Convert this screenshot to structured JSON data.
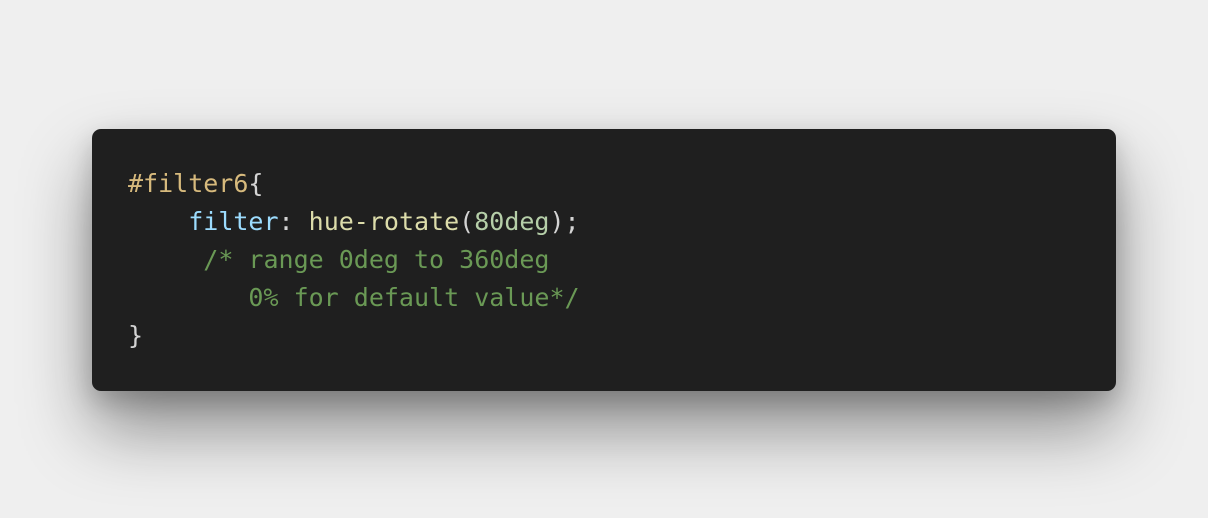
{
  "snippet": {
    "selector": "#filter6",
    "open_brace": "{",
    "property": "filter",
    "colon": ": ",
    "function_name": "hue-rotate",
    "paren_open": "(",
    "argument": "80deg",
    "paren_close_semicolon": ");",
    "comment_line_1": "/* range 0deg to 360deg",
    "comment_line_2": "0% for default value*/",
    "close_brace": "}"
  },
  "colors": {
    "page_background": "#efefef",
    "editor_background": "#1f1f1f",
    "selector": "#d7ba7d",
    "property": "#9cdcfe",
    "function": "#dcdcaa",
    "number": "#b5cea8",
    "comment": "#6a9955",
    "punctuation": "#d4d4d4"
  }
}
